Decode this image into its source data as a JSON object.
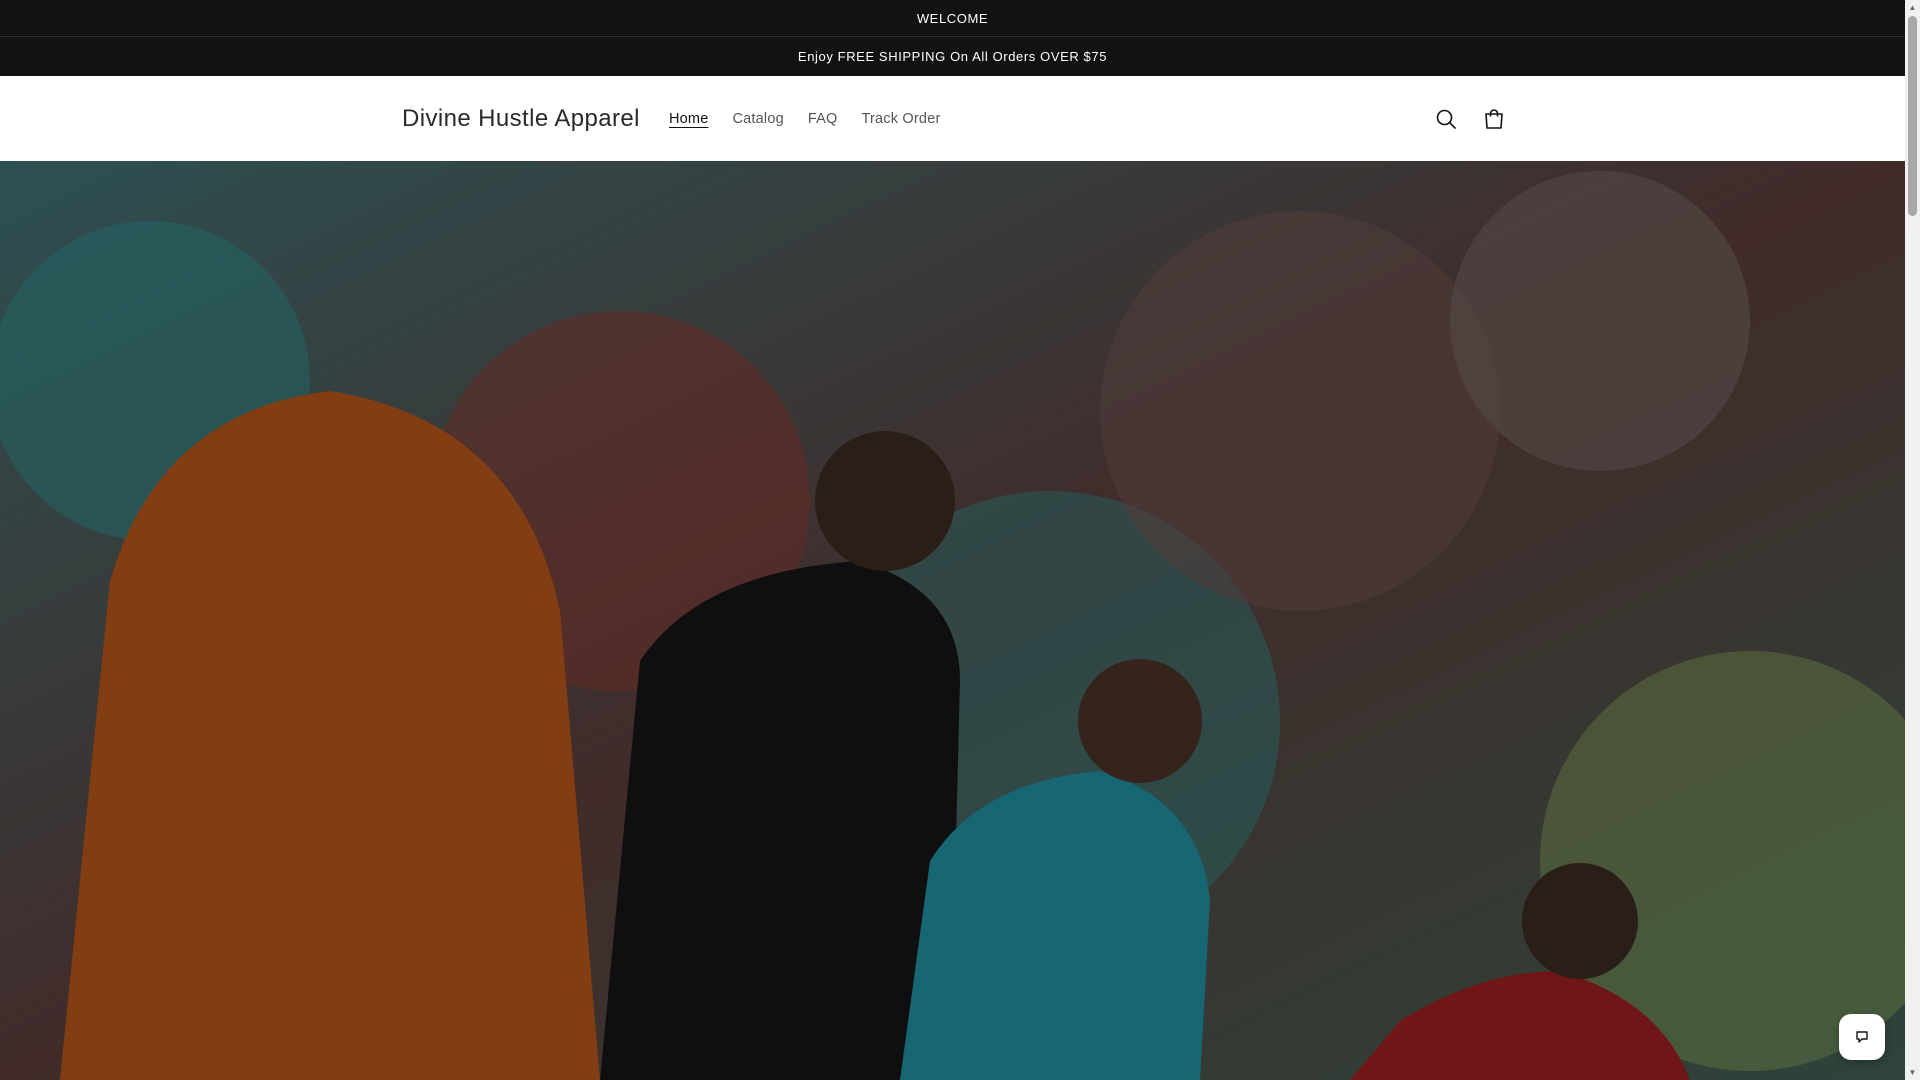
{
  "announcements": {
    "welcome": "WELCOME",
    "shipping": "Enjoy FREE SHIPPING On All Orders OVER $75"
  },
  "header": {
    "brand": "Divine Hustle Apparel",
    "nav": [
      {
        "label": "Home",
        "active": true
      },
      {
        "label": "Catalog",
        "active": false
      },
      {
        "label": "FAQ",
        "active": false
      },
      {
        "label": "Track Order",
        "active": false
      }
    ],
    "icons": [
      "search-icon",
      "cart-icon"
    ]
  },
  "hero": {
    "image": "street-apparel-photo"
  },
  "chat": {
    "icon": "chat-icon"
  },
  "colors": {
    "announcement_bg": "#121212",
    "announcement_text": "#ffffff",
    "header_bg": "#ffffff",
    "brand_text": "#2a2a2a",
    "nav_text": "#555555"
  }
}
